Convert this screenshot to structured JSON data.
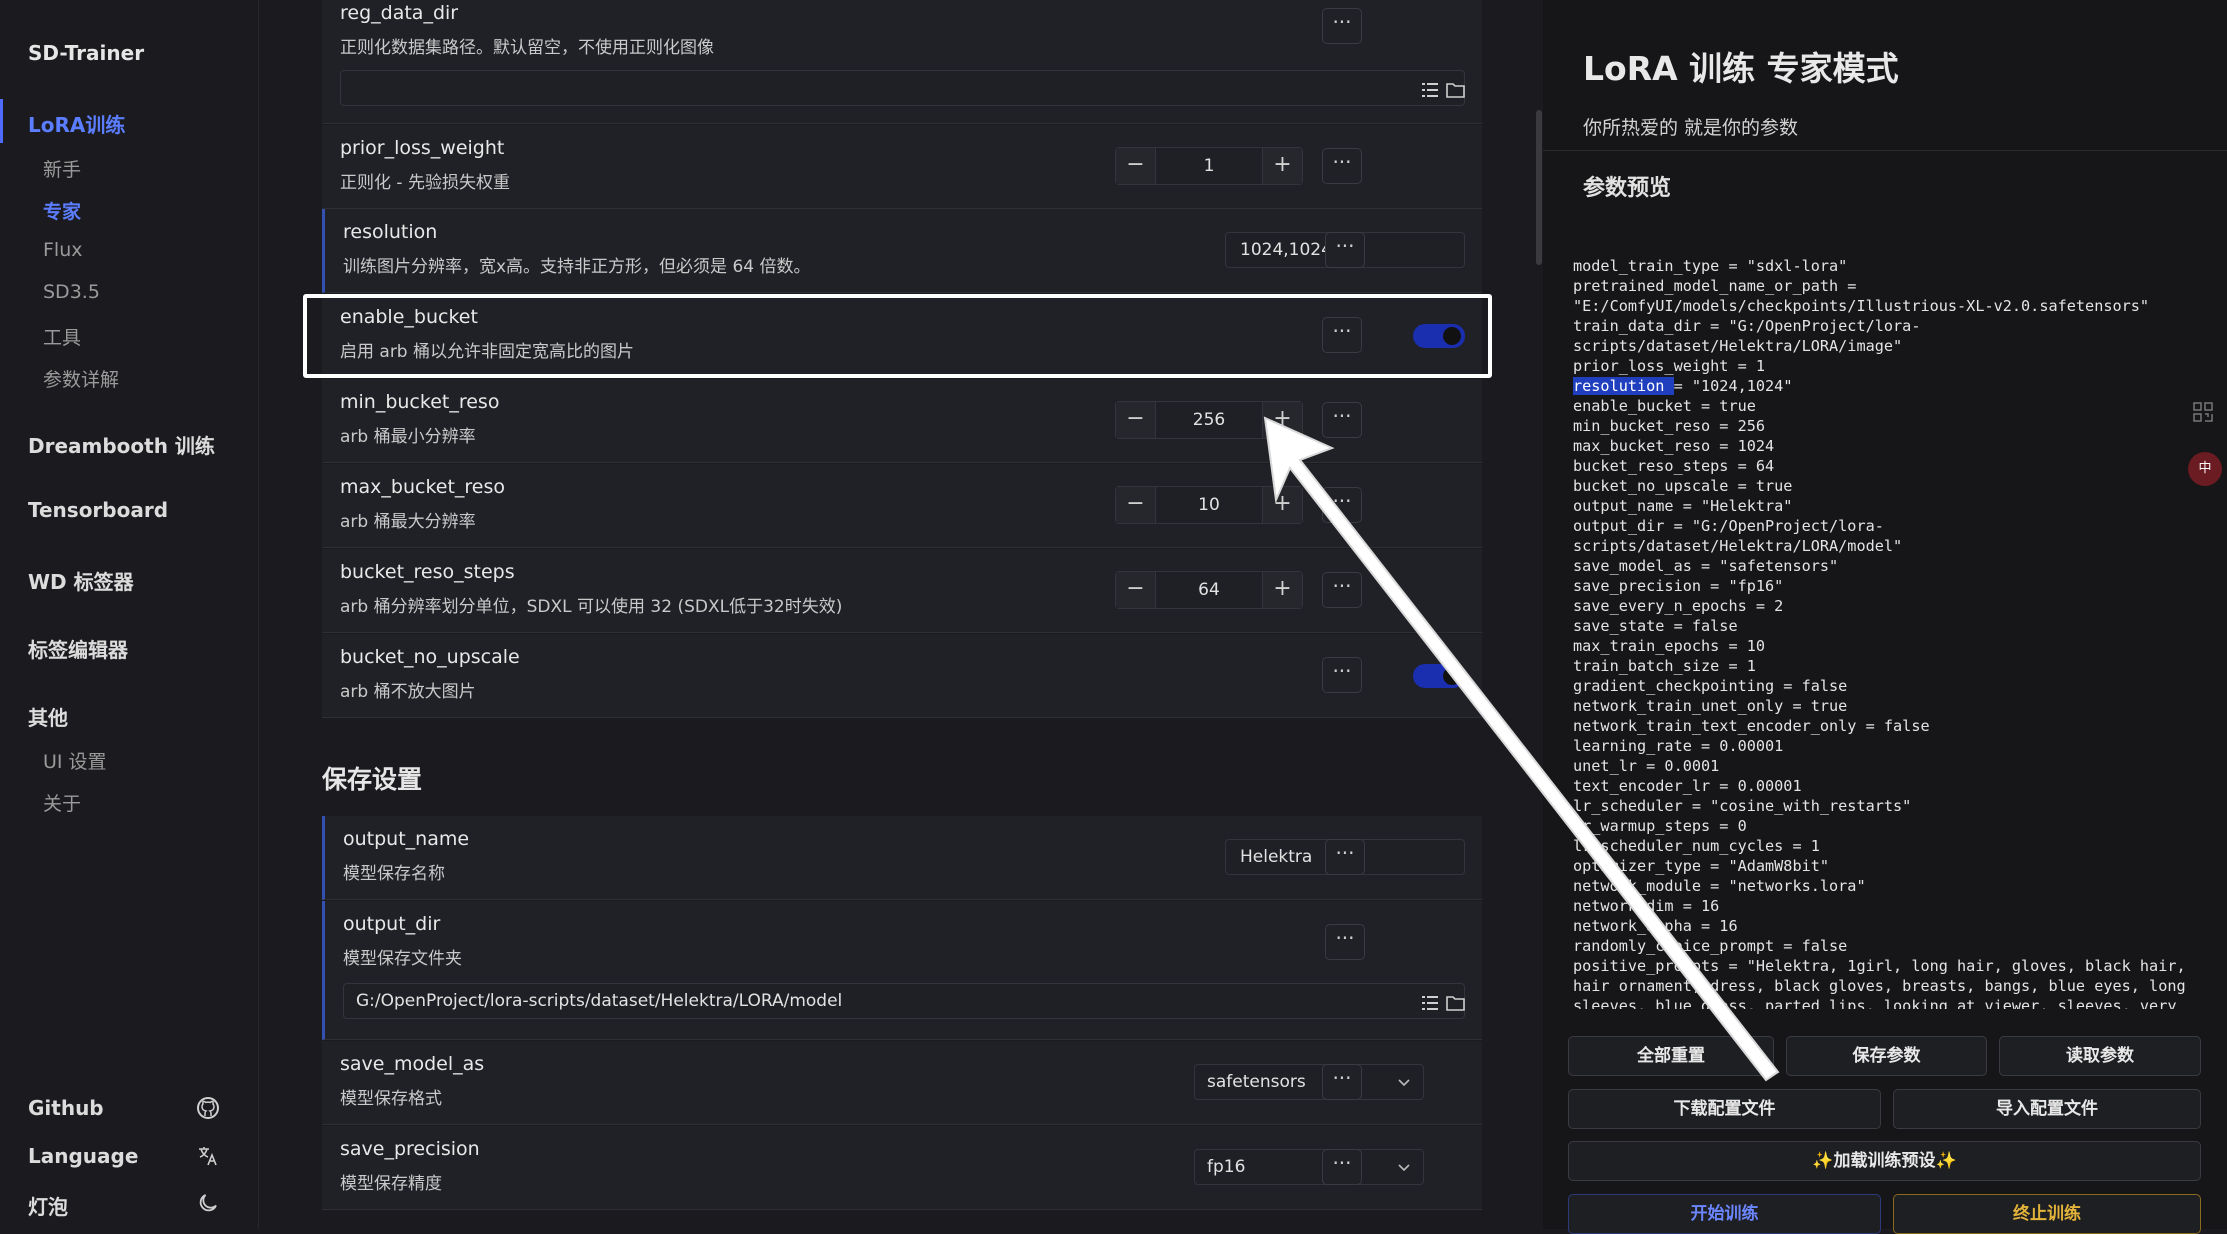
{
  "sidebar": {
    "brand": "SD-Trainer",
    "items": [
      {
        "label": "LoRA训练",
        "active": true
      },
      {
        "label": "Dreambooth 训练"
      },
      {
        "label": "Tensorboard"
      },
      {
        "label": "WD 标签器"
      },
      {
        "label": "标签编辑器"
      },
      {
        "label": "其他"
      }
    ],
    "lora_sub": [
      "新手",
      "专家",
      "Flux",
      "SD3.5",
      "工具",
      "参数详解"
    ],
    "other_sub": [
      "UI 设置",
      "关于"
    ],
    "bottom": [
      {
        "label": "Github",
        "icon": "github-icon"
      },
      {
        "label": "Language",
        "icon": "translate-icon"
      },
      {
        "label": "灯泡",
        "icon": "moon-icon"
      }
    ]
  },
  "main": {
    "rows": {
      "reg_data_dir": {
        "name": "reg_data_dir",
        "desc": "正则化数据集路径。默认留空，不使用正则化图像",
        "value": ""
      },
      "prior_loss_weight": {
        "name": "prior_loss_weight",
        "desc": "正则化 - 先验损失权重",
        "value": "1"
      },
      "resolution": {
        "name": "resolution",
        "desc": "训练图片分辨率，宽x高。支持非正方形，但必须是 64 倍数。",
        "value": "1024,1024"
      },
      "enable_bucket": {
        "name": "enable_bucket",
        "desc": "启用 arb 桶以允许非固定宽高比的图片",
        "value": true
      },
      "min_bucket_reso": {
        "name": "min_bucket_reso",
        "desc": "arb 桶最小分辨率",
        "value": "256"
      },
      "max_bucket_reso": {
        "name": "max_bucket_reso",
        "desc": "arb 桶最大分辨率",
        "value": "10"
      },
      "bucket_reso_steps": {
        "name": "bucket_reso_steps",
        "desc": "arb 桶分辨率划分单位，SDXL 可以使用 32 (SDXL低于32时失效)",
        "value": "64"
      },
      "bucket_no_upscale": {
        "name": "bucket_no_upscale",
        "desc": "arb 桶不放大图片",
        "value": true
      },
      "output_name": {
        "name": "output_name",
        "desc": "模型保存名称",
        "value": "Helektra"
      },
      "output_dir": {
        "name": "output_dir",
        "desc": "模型保存文件夹",
        "value": "G:/OpenProject/lora-scripts/dataset/Helektra/LORA/model"
      },
      "save_model_as": {
        "name": "save_model_as",
        "desc": "模型保存格式",
        "value": "safetensors"
      },
      "save_precision": {
        "name": "save_precision",
        "desc": "模型保存精度",
        "value": "fp16"
      }
    },
    "section_save": "保存设置",
    "more_label": "···",
    "minus_label": "−",
    "plus_label": "+"
  },
  "panel": {
    "title": "LoRA 训练 专家模式",
    "subtitle": "你所热爱的 就是你的参数",
    "preview_heading": "参数预览",
    "code_lines": [
      "model_train_type = \"sdxl-lora\"",
      "pretrained_model_name_or_path =",
      "\"E:/ComfyUI/models/checkpoints/Illustrious-XL-v2.0.safetensors\"",
      "train_data_dir = \"G:/OpenProject/lora-",
      "scripts/dataset/Helektra/LORA/image\"",
      "prior_loss_weight = 1",
      "resolution = \"1024,1024\"",
      "enable_bucket = true",
      "min_bucket_reso = 256",
      "max_bucket_reso = 1024",
      "bucket_reso_steps = 64",
      "bucket_no_upscale = true",
      "output_name = \"Helektra\"",
      "output_dir = \"G:/OpenProject/lora-",
      "scripts/dataset/Helektra/LORA/model\"",
      "save_model_as = \"safetensors\"",
      "save_precision = \"fp16\"",
      "save_every_n_epochs = 2",
      "save_state = false",
      "max_train_epochs = 10",
      "train_batch_size = 1",
      "gradient_checkpointing = false",
      "network_train_unet_only = true",
      "network_train_text_encoder_only = false",
      "learning_rate = 0.00001",
      "unet_lr = 0.0001",
      "text_encoder_lr = 0.00001",
      "lr_scheduler = \"cosine_with_restarts\"",
      "lr_warmup_steps = 0",
      "lr_scheduler_num_cycles = 1",
      "optimizer_type = \"AdamW8bit\"",
      "network_module = \"networks.lora\"",
      "network_dim = 16",
      "network_alpha = 16",
      "randomly_choice_prompt = false",
      "positive_prompts = \"Helektra, 1girl, long hair, gloves, black hair,",
      "hair ornament, dress, black gloves, breasts, bangs, blue eyes, long",
      "sleeves, blue dress, parted lips, looking at viewer, sleeves, very"
    ],
    "selected_token": "resolution",
    "buttons": {
      "reset_all": "全部重置",
      "save_params": "保存参数",
      "load_params": "读取参数",
      "download_config": "下载配置文件",
      "import_config": "导入配置文件",
      "load_preset": "✨加载训练预设✨",
      "start_training": "开始训练",
      "stop_training": "终止训练"
    },
    "translate_badge": "中"
  },
  "colors": {
    "accent": "#5b7dff",
    "toggle_on": "#1a2fb0",
    "stop": "#e4b43a",
    "annotation": "#ffffff"
  }
}
